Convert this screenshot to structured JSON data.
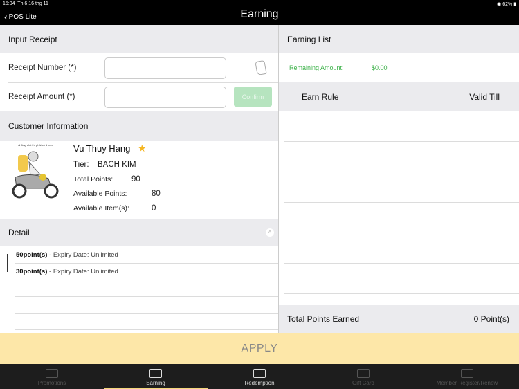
{
  "status": {
    "time": "15:04",
    "date": "Th 6 16 thg 11",
    "battery": "62%"
  },
  "header": {
    "back": "POS Lite",
    "title": "Earning"
  },
  "input_receipt": {
    "title": "Input Receipt",
    "receipt_number_label": "Receipt Number (*)",
    "receipt_number_value": "",
    "receipt_amount_label": "Receipt Amount (*)",
    "receipt_amount_value": "",
    "confirm": "Confirm"
  },
  "customer": {
    "title": "Customer Information",
    "avatar_caption": "những chú thì phải có 1 con",
    "name": "Vu Thuy Hang",
    "tier_label": "Tier:",
    "tier": "BẠCH KIM",
    "total_label": "Total Points:",
    "total": "90",
    "available_label": "Available Points:",
    "available": "80",
    "items_label": "Available Item(s):",
    "items": "0"
  },
  "detail": {
    "title": "Detail",
    "items": [
      {
        "points": "50point(s)",
        "expiry": " - Expiry Date: Unlimited"
      },
      {
        "points": "30point(s)",
        "expiry": " - Expiry Date: Unlimited"
      }
    ]
  },
  "earning_list": {
    "title": "Earning List",
    "remaining_label": "Remaining Amount:",
    "remaining_value": "$0.00",
    "col_rule": "Earn Rule",
    "col_valid": "Valid Till",
    "total_label": "Total Points Earned",
    "total_value": "0 Point(s)"
  },
  "apply": "APPLY",
  "tabs": [
    {
      "label": "Promotions"
    },
    {
      "label": "Earning"
    },
    {
      "label": "Redemption"
    },
    {
      "label": "Gift Card"
    },
    {
      "label": "Member Register/Renew"
    }
  ],
  "colors": {
    "green": "#3db24a",
    "apply_bg": "#fde7a8",
    "confirm_bg": "#b6e4bf"
  }
}
